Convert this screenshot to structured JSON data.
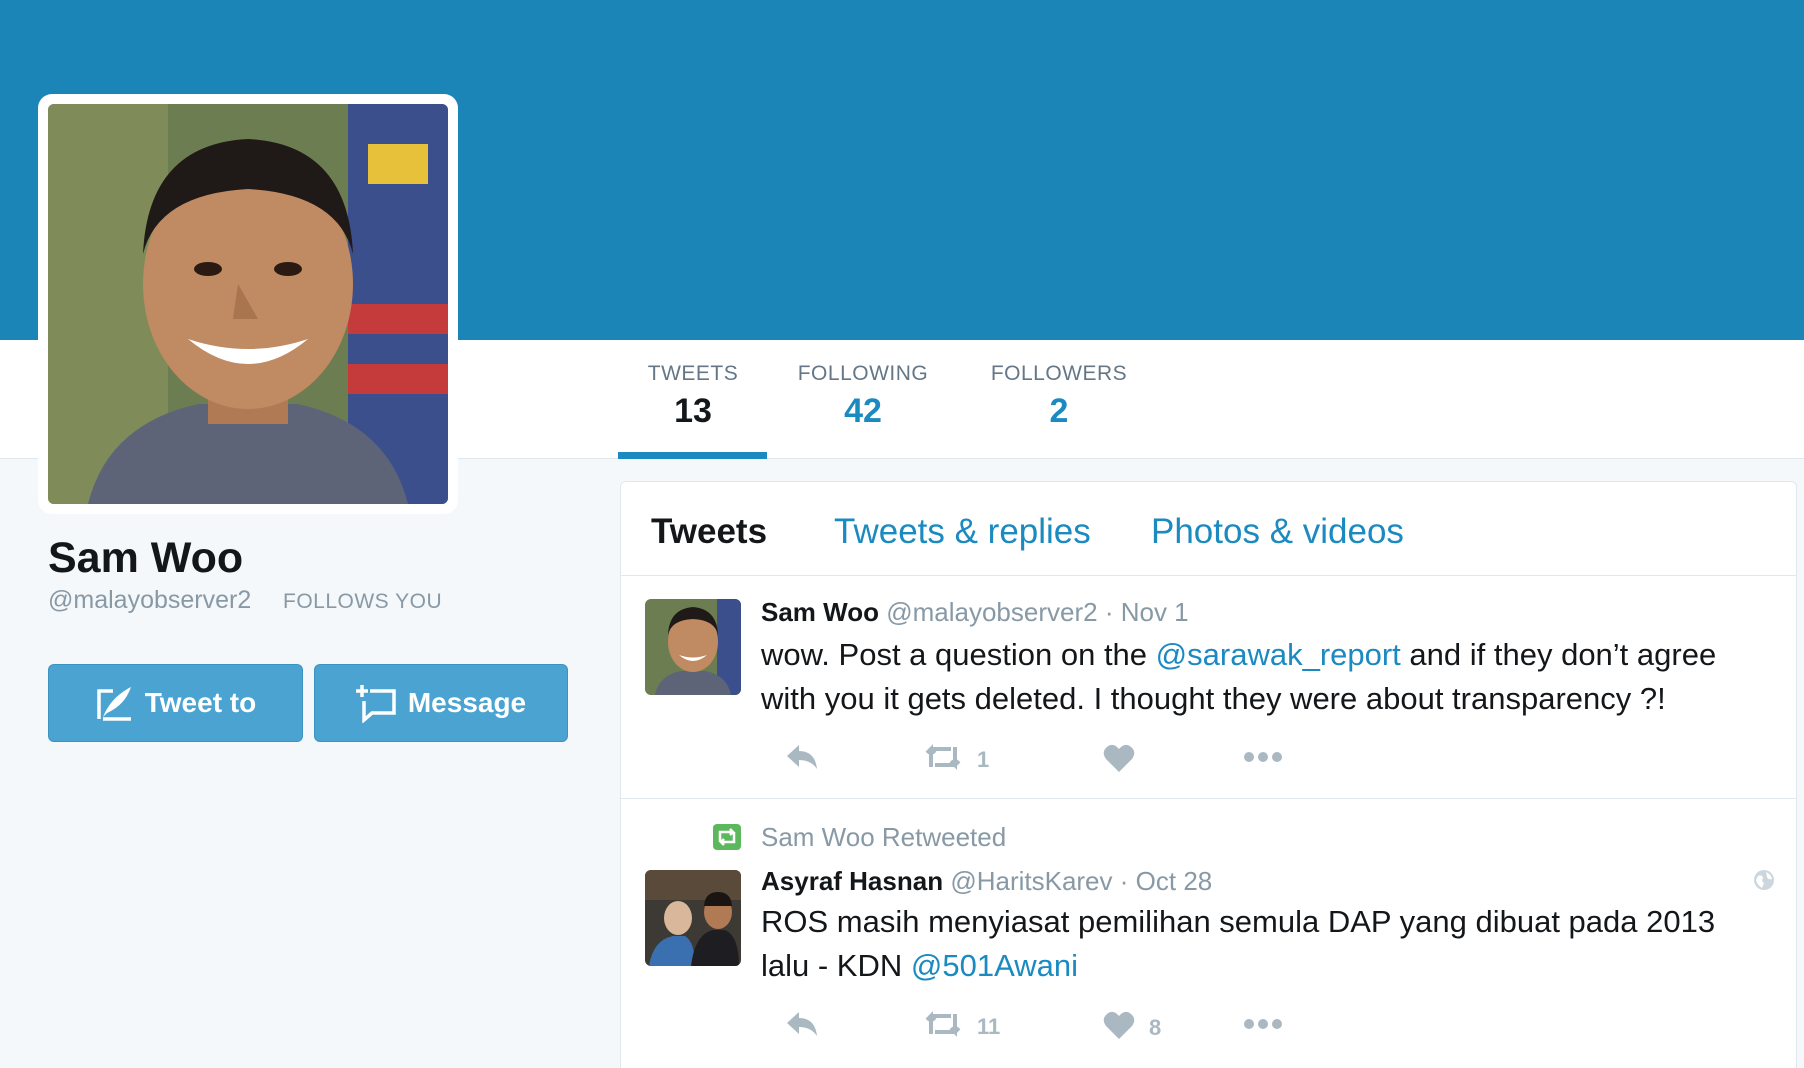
{
  "colors": {
    "banner": "#1b85b8",
    "accent": "#1b8ac0",
    "button": "#4aa3d1"
  },
  "profile": {
    "name": "Sam Woo",
    "handle": "@malayobserver2",
    "follows_you": "FOLLOWS YOU",
    "tweet_to_label": "Tweet to",
    "message_label": "Message"
  },
  "stats": [
    {
      "label": "TWEETS",
      "value": "13"
    },
    {
      "label": "FOLLOWING",
      "value": "42"
    },
    {
      "label": "FOLLOWERS",
      "value": "2"
    }
  ],
  "tabs": [
    "Tweets",
    "Tweets & replies",
    "Photos & videos"
  ],
  "tweets": [
    {
      "author": "Sam Woo",
      "handle": "@malayobserver2",
      "date": "· Nov 1",
      "text_before": "wow. Post a question on the",
      "mention": "@sarawak_report",
      "text_after": "and if they don’t agree with you it gets deleted. I thought they were about transparency ?!",
      "retweets": "1",
      "likes": ""
    },
    {
      "retweeted_by": "Sam Woo Retweeted",
      "author": "Asyraf Hasnan",
      "handle": "@HaritsKarev",
      "date": "· Oct 28",
      "text_before": "ROS masih menyiasat pemilihan semula DAP yang dibuat pada 2013 lalu - KDN",
      "mention": "@501Awani",
      "text_after": "",
      "retweets": "11",
      "likes": "8"
    }
  ]
}
